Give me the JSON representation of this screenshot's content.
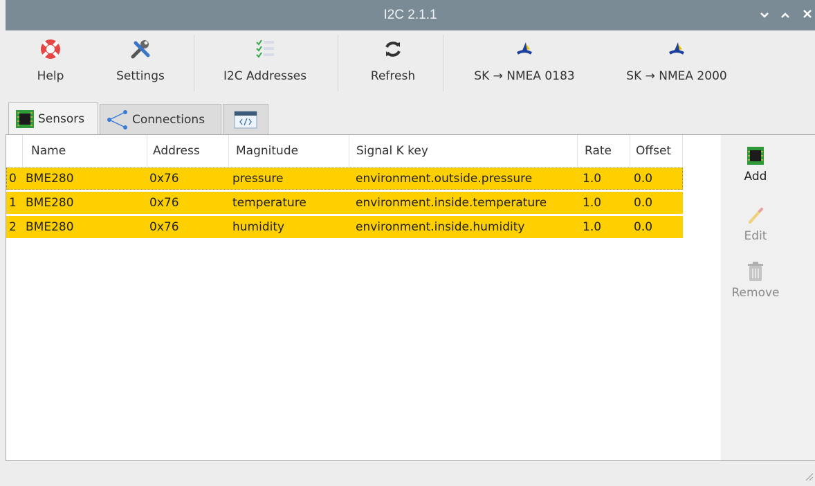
{
  "window": {
    "title": "I2C 2.1.1",
    "controls": [
      "⌄",
      "^",
      "✕"
    ]
  },
  "toolbar": {
    "help": "Help",
    "settings": "Settings",
    "i2c_addresses": "I2C Addresses",
    "refresh": "Refresh",
    "sk_nmea0183": "SK → NMEA 0183",
    "sk_nmea2000": "SK → NMEA 2000"
  },
  "tabs": {
    "sensors": "Sensors",
    "connections": "Connections"
  },
  "table": {
    "columns": [
      "Name",
      "Address",
      "Magnitude",
      "Signal K key",
      "Rate",
      "Offset"
    ],
    "rows": [
      {
        "index": "0",
        "name": "BME280",
        "address": "0x76",
        "magnitude": "pressure",
        "key": "environment.outside.pressure",
        "rate": "1.0",
        "offset": "0.0"
      },
      {
        "index": "1",
        "name": "BME280",
        "address": "0x76",
        "magnitude": "temperature",
        "key": "environment.inside.temperature",
        "rate": "1.0",
        "offset": "0.0"
      },
      {
        "index": "2",
        "name": "BME280",
        "address": "0x76",
        "magnitude": "humidity",
        "key": "environment.inside.humidity",
        "rate": "1.0",
        "offset": "0.0"
      }
    ],
    "row_highlight_color": "#ffd000"
  },
  "sidebar": {
    "add": "Add",
    "edit": "Edit",
    "remove": "Remove"
  },
  "colors": {
    "titlebar": "#7a8b96",
    "selected_row": "#ffd000"
  }
}
